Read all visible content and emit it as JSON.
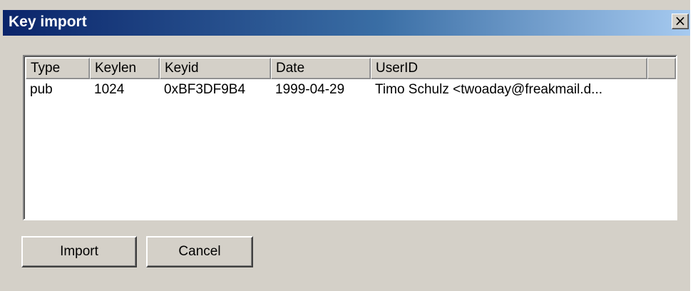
{
  "window": {
    "title": "Key import",
    "close_glyph": "×",
    "close_icon": "close-icon"
  },
  "list": {
    "columns": [
      "Type",
      "Keylen",
      "Keyid",
      "Date",
      "UserID"
    ],
    "rows": [
      {
        "type": "pub",
        "keylen": "1024",
        "keyid": "0xBF3DF9B4",
        "date": "1999-04-29",
        "userid": "Timo Schulz <twoaday@freakmail.d..."
      }
    ]
  },
  "buttons": {
    "import_label": "Import",
    "cancel_label": "Cancel"
  },
  "colors": {
    "title_start": "#0a246a",
    "title_end": "#a6caf0",
    "face": "#d4d0c8"
  }
}
